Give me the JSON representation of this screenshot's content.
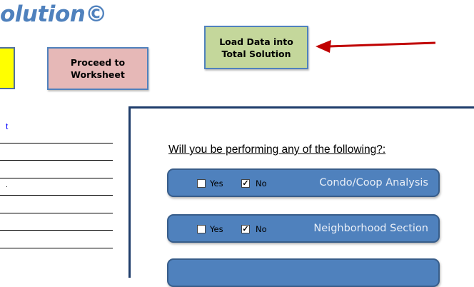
{
  "header": {
    "title_fragment": "olution©"
  },
  "buttons": {
    "proceed_line1": "Proceed to",
    "proceed_line2": "Worksheet",
    "load_line1": "Load Data into",
    "load_line2": "Total Solution"
  },
  "left_list": {
    "link_fragment": "t",
    "row_marker": "."
  },
  "form": {
    "question": "Will you be performing any of the following?:",
    "options": [
      {
        "title": "Condo/Coop Analysis",
        "yes_label": "Yes",
        "no_label": "No",
        "yes_checked": false,
        "no_checked": true
      },
      {
        "title": "Neighborhood Section",
        "yes_label": "Yes",
        "no_label": "No",
        "yes_checked": false,
        "no_checked": true
      }
    ],
    "check_mark": "✓"
  },
  "colors": {
    "title": "#4f81bd",
    "proceed_button": "#e6b8b7",
    "load_button": "#c4d79b",
    "option_row": "#4f81bd",
    "arrow": "#c00000",
    "yellow_button": "#ffff00"
  }
}
